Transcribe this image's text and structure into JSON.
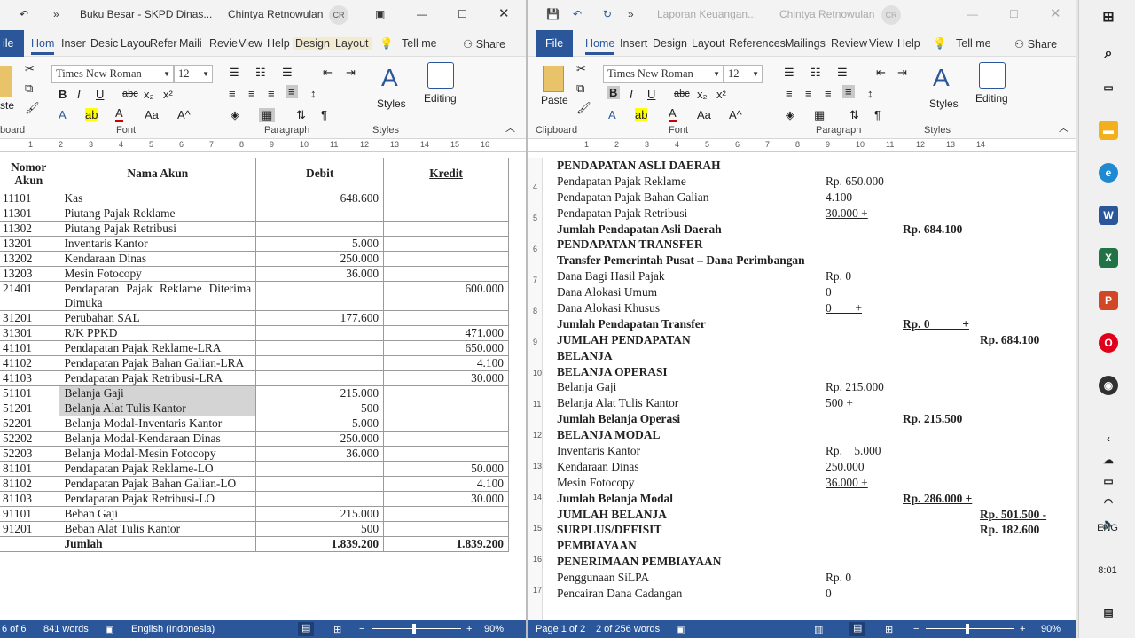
{
  "left": {
    "title": "Buku Besar - SKPD Dinas...",
    "user": "Chintya Retnowulan",
    "initials": "CR",
    "tabs": [
      "ile",
      "Hom",
      "Inser",
      "Desic",
      "Layou",
      "Refer",
      "Maili",
      "Revie",
      "View",
      "Help",
      "Design",
      "Layout"
    ],
    "tellme": "Tell me",
    "share": "Share",
    "font": "Times New Roman",
    "size": "12",
    "groups": {
      "clip": "board",
      "font": "Font",
      "para": "Paragraph",
      "styles": "Styles"
    },
    "styles_label": "Styles",
    "editing_label": "Editing",
    "paste_label": "ste",
    "ruler": [
      "1",
      "2",
      "3",
      "4",
      "5",
      "6",
      "7",
      "8",
      "9",
      "10",
      "11",
      "12",
      "13",
      "14",
      "15",
      "16"
    ],
    "headers": [
      "Nomor Akun",
      "Nama Akun",
      "Debit",
      "Kredit"
    ],
    "rows": [
      [
        "11101",
        "Kas",
        "648.600",
        ""
      ],
      [
        "11301",
        "Piutang Pajak Reklame",
        "",
        ""
      ],
      [
        "11302",
        "Piutang Pajak Retribusi",
        "",
        ""
      ],
      [
        "13201",
        "Inventaris Kantor",
        "5.000",
        ""
      ],
      [
        "13202",
        "Kendaraan Dinas",
        "250.000",
        ""
      ],
      [
        "13203",
        "Mesin Fotocopy",
        "36.000",
        ""
      ],
      [
        "21401",
        "Pendapatan Pajak Reklame Diterima Dimuka",
        "",
        "600.000"
      ],
      [
        "31201",
        "Perubahan SAL",
        "177.600",
        ""
      ],
      [
        "31301",
        "R/K PPKD",
        "",
        "471.000"
      ],
      [
        "41101",
        "Pendapatan Pajak Reklame-LRA",
        "",
        "650.000"
      ],
      [
        "41102",
        "Pendapatan Pajak Bahan Galian-LRA",
        "",
        "4.100"
      ],
      [
        "41103",
        "Pendapatan Pajak Retribusi-LRA",
        "",
        "30.000"
      ],
      [
        "51101",
        "Belanja Gaji",
        "215.000",
        ""
      ],
      [
        "51201",
        "Belanja Alat Tulis Kantor",
        "500",
        ""
      ],
      [
        "52201",
        "Belanja Modal-Inventaris Kantor",
        "5.000",
        ""
      ],
      [
        "52202",
        "Belanja Modal-Kendaraan Dinas",
        "250.000",
        ""
      ],
      [
        "52203",
        "Belanja Modal-Mesin Fotocopy",
        "36.000",
        ""
      ],
      [
        "81101",
        "Pendapatan Pajak Reklame-LO",
        "",
        "50.000"
      ],
      [
        "81102",
        "Pendapatan Pajak Bahan Galian-LO",
        "",
        "4.100"
      ],
      [
        "81103",
        "Pendapatan Pajak Retribusi-LO",
        "",
        "30.000"
      ],
      [
        "91101",
        "Beban Gaji",
        "215.000",
        ""
      ],
      [
        "91201",
        "Beban Alat Tulis Kantor",
        "500",
        ""
      ]
    ],
    "total": {
      "label": "Jumlah",
      "debit": "1.839.200",
      "kredit": "1.839.200"
    },
    "status": {
      "page": "6 of 6",
      "words": "841 words",
      "lang": "English (Indonesia)",
      "zoom": "90%"
    }
  },
  "right": {
    "title": "Laporan Keuangan...",
    "user": "Chintya Retnowulan",
    "initials": "CR",
    "tabs": [
      "File",
      "Home",
      "Insert",
      "Design",
      "Layout",
      "References",
      "Mailings",
      "Review",
      "View",
      "Help"
    ],
    "tellme": "Tell me",
    "share": "Share",
    "font": "Times New Roman",
    "size": "12",
    "groups": {
      "clip": "Clipboard",
      "font": "Font",
      "para": "Paragraph",
      "styles": "Styles"
    },
    "styles_label": "Styles",
    "editing_label": "Editing",
    "paste_label": "Paste",
    "ruler": [
      "1",
      "2",
      "3",
      "4",
      "5",
      "6",
      "7",
      "8",
      "9",
      "10",
      "11",
      "12",
      "13",
      "14"
    ],
    "vruler": [
      "4",
      "5",
      "6",
      "7",
      "8",
      "9",
      "10",
      "11",
      "12",
      "13",
      "14",
      "15",
      "16",
      "17"
    ],
    "lines": [
      {
        "a": "PENDAPATAN ASLI DAERAH",
        "b": true
      },
      {
        "a": "Pendapatan Pajak Reklame",
        "c1": "Rp. 650.000"
      },
      {
        "a": "Pendapatan Pajak Bahan Galian",
        "c1": "4.100"
      },
      {
        "a": "Pendapatan Pajak Retribusi",
        "c1": "30.000 +",
        "u1": true
      },
      {
        "a": "Jumlah Pendapatan Asli Daerah",
        "b": true,
        "c2": "Rp. 684.100"
      },
      {
        "a": "PENDAPATAN TRANSFER",
        "b": true
      },
      {
        "a": "Transfer Pemerintah Pusat – Dana Perimbangan",
        "b": true
      },
      {
        "a": "Dana Bagi Hasil Pajak",
        "c1": "Rp. 0"
      },
      {
        "a": "Dana Alokasi Umum",
        "c1": "0"
      },
      {
        "a": "Dana Alokasi Khusus",
        "c1": "0        +",
        "u1": true
      },
      {
        "a": "Jumlah Pendapatan Transfer",
        "b": true,
        "c2": "Rp. 0           +",
        "u2": true
      },
      {
        "a": "JUMLAH PENDAPATAN",
        "b": true,
        "c3": "Rp. 684.100"
      },
      {
        "a": "BELANJA",
        "b": true
      },
      {
        "a": "BELANJA OPERASI",
        "b": true
      },
      {
        "a": "Belanja Gaji",
        "c1": "Rp. 215.000"
      },
      {
        "a": "Belanja Alat Tulis Kantor",
        "c1": "500 +",
        "u1": true
      },
      {
        "a": "Jumlah Belanja Operasi",
        "b": true,
        "c2": "Rp. 215.500"
      },
      {
        "a": "BELANJA MODAL",
        "b": true
      },
      {
        "a": "Inventaris Kantor",
        "c1": "Rp.    5.000"
      },
      {
        "a": "Kendaraan Dinas",
        "c1": "250.000"
      },
      {
        "a": "Mesin Fotocopy",
        "c1": "36.000 +",
        "u1": true
      },
      {
        "a": "Jumlah Belanja Modal",
        "b": true,
        "c2": "Rp. 286.000 +",
        "u2": true
      },
      {
        "a": "JUMLAH BELANJA",
        "b": true,
        "c3": "Rp. 501.500 -",
        "u3": true
      },
      {
        "a": "SURPLUS/DEFISIT",
        "b": true,
        "c3": "Rp. 182.600"
      },
      {
        "a": "PEMBIAYAAN",
        "b": true
      },
      {
        "a": "PENERIMAAN PEMBIAYAAN",
        "b": true
      },
      {
        "a": "Penggunaan SiLPA",
        "c1": "Rp. 0"
      },
      {
        "a": "Pencairan Dana Cadangan",
        "c1": "0"
      }
    ],
    "status": {
      "page": "Page 1 of 2",
      "words": "2 of 256 words",
      "zoom": "90%"
    }
  },
  "taskbar": {
    "lang": "ENG",
    "time": "8:01"
  }
}
